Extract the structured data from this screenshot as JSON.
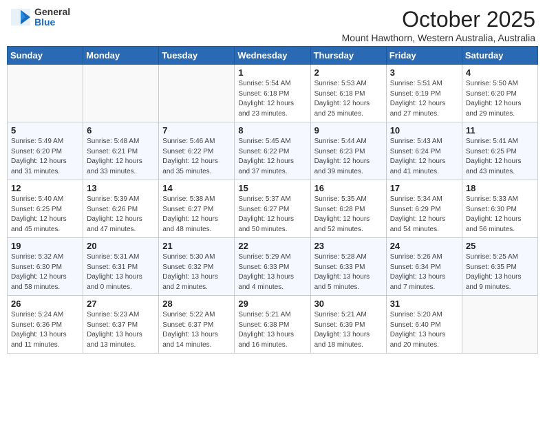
{
  "logo": {
    "general": "General",
    "blue": "Blue"
  },
  "header": {
    "title": "October 2025",
    "subtitle": "Mount Hawthorn, Western Australia, Australia"
  },
  "weekdays": [
    "Sunday",
    "Monday",
    "Tuesday",
    "Wednesday",
    "Thursday",
    "Friday",
    "Saturday"
  ],
  "weeks": [
    [
      {
        "day": "",
        "info": ""
      },
      {
        "day": "",
        "info": ""
      },
      {
        "day": "",
        "info": ""
      },
      {
        "day": "1",
        "info": "Sunrise: 5:54 AM\nSunset: 6:18 PM\nDaylight: 12 hours\nand 23 minutes."
      },
      {
        "day": "2",
        "info": "Sunrise: 5:53 AM\nSunset: 6:18 PM\nDaylight: 12 hours\nand 25 minutes."
      },
      {
        "day": "3",
        "info": "Sunrise: 5:51 AM\nSunset: 6:19 PM\nDaylight: 12 hours\nand 27 minutes."
      },
      {
        "day": "4",
        "info": "Sunrise: 5:50 AM\nSunset: 6:20 PM\nDaylight: 12 hours\nand 29 minutes."
      }
    ],
    [
      {
        "day": "5",
        "info": "Sunrise: 5:49 AM\nSunset: 6:20 PM\nDaylight: 12 hours\nand 31 minutes."
      },
      {
        "day": "6",
        "info": "Sunrise: 5:48 AM\nSunset: 6:21 PM\nDaylight: 12 hours\nand 33 minutes."
      },
      {
        "day": "7",
        "info": "Sunrise: 5:46 AM\nSunset: 6:22 PM\nDaylight: 12 hours\nand 35 minutes."
      },
      {
        "day": "8",
        "info": "Sunrise: 5:45 AM\nSunset: 6:22 PM\nDaylight: 12 hours\nand 37 minutes."
      },
      {
        "day": "9",
        "info": "Sunrise: 5:44 AM\nSunset: 6:23 PM\nDaylight: 12 hours\nand 39 minutes."
      },
      {
        "day": "10",
        "info": "Sunrise: 5:43 AM\nSunset: 6:24 PM\nDaylight: 12 hours\nand 41 minutes."
      },
      {
        "day": "11",
        "info": "Sunrise: 5:41 AM\nSunset: 6:25 PM\nDaylight: 12 hours\nand 43 minutes."
      }
    ],
    [
      {
        "day": "12",
        "info": "Sunrise: 5:40 AM\nSunset: 6:25 PM\nDaylight: 12 hours\nand 45 minutes."
      },
      {
        "day": "13",
        "info": "Sunrise: 5:39 AM\nSunset: 6:26 PM\nDaylight: 12 hours\nand 47 minutes."
      },
      {
        "day": "14",
        "info": "Sunrise: 5:38 AM\nSunset: 6:27 PM\nDaylight: 12 hours\nand 48 minutes."
      },
      {
        "day": "15",
        "info": "Sunrise: 5:37 AM\nSunset: 6:27 PM\nDaylight: 12 hours\nand 50 minutes."
      },
      {
        "day": "16",
        "info": "Sunrise: 5:35 AM\nSunset: 6:28 PM\nDaylight: 12 hours\nand 52 minutes."
      },
      {
        "day": "17",
        "info": "Sunrise: 5:34 AM\nSunset: 6:29 PM\nDaylight: 12 hours\nand 54 minutes."
      },
      {
        "day": "18",
        "info": "Sunrise: 5:33 AM\nSunset: 6:30 PM\nDaylight: 12 hours\nand 56 minutes."
      }
    ],
    [
      {
        "day": "19",
        "info": "Sunrise: 5:32 AM\nSunset: 6:30 PM\nDaylight: 12 hours\nand 58 minutes."
      },
      {
        "day": "20",
        "info": "Sunrise: 5:31 AM\nSunset: 6:31 PM\nDaylight: 13 hours\nand 0 minutes."
      },
      {
        "day": "21",
        "info": "Sunrise: 5:30 AM\nSunset: 6:32 PM\nDaylight: 13 hours\nand 2 minutes."
      },
      {
        "day": "22",
        "info": "Sunrise: 5:29 AM\nSunset: 6:33 PM\nDaylight: 13 hours\nand 4 minutes."
      },
      {
        "day": "23",
        "info": "Sunrise: 5:28 AM\nSunset: 6:33 PM\nDaylight: 13 hours\nand 5 minutes."
      },
      {
        "day": "24",
        "info": "Sunrise: 5:26 AM\nSunset: 6:34 PM\nDaylight: 13 hours\nand 7 minutes."
      },
      {
        "day": "25",
        "info": "Sunrise: 5:25 AM\nSunset: 6:35 PM\nDaylight: 13 hours\nand 9 minutes."
      }
    ],
    [
      {
        "day": "26",
        "info": "Sunrise: 5:24 AM\nSunset: 6:36 PM\nDaylight: 13 hours\nand 11 minutes."
      },
      {
        "day": "27",
        "info": "Sunrise: 5:23 AM\nSunset: 6:37 PM\nDaylight: 13 hours\nand 13 minutes."
      },
      {
        "day": "28",
        "info": "Sunrise: 5:22 AM\nSunset: 6:37 PM\nDaylight: 13 hours\nand 14 minutes."
      },
      {
        "day": "29",
        "info": "Sunrise: 5:21 AM\nSunset: 6:38 PM\nDaylight: 13 hours\nand 16 minutes."
      },
      {
        "day": "30",
        "info": "Sunrise: 5:21 AM\nSunset: 6:39 PM\nDaylight: 13 hours\nand 18 minutes."
      },
      {
        "day": "31",
        "info": "Sunrise: 5:20 AM\nSunset: 6:40 PM\nDaylight: 13 hours\nand 20 minutes."
      },
      {
        "day": "",
        "info": ""
      }
    ]
  ]
}
